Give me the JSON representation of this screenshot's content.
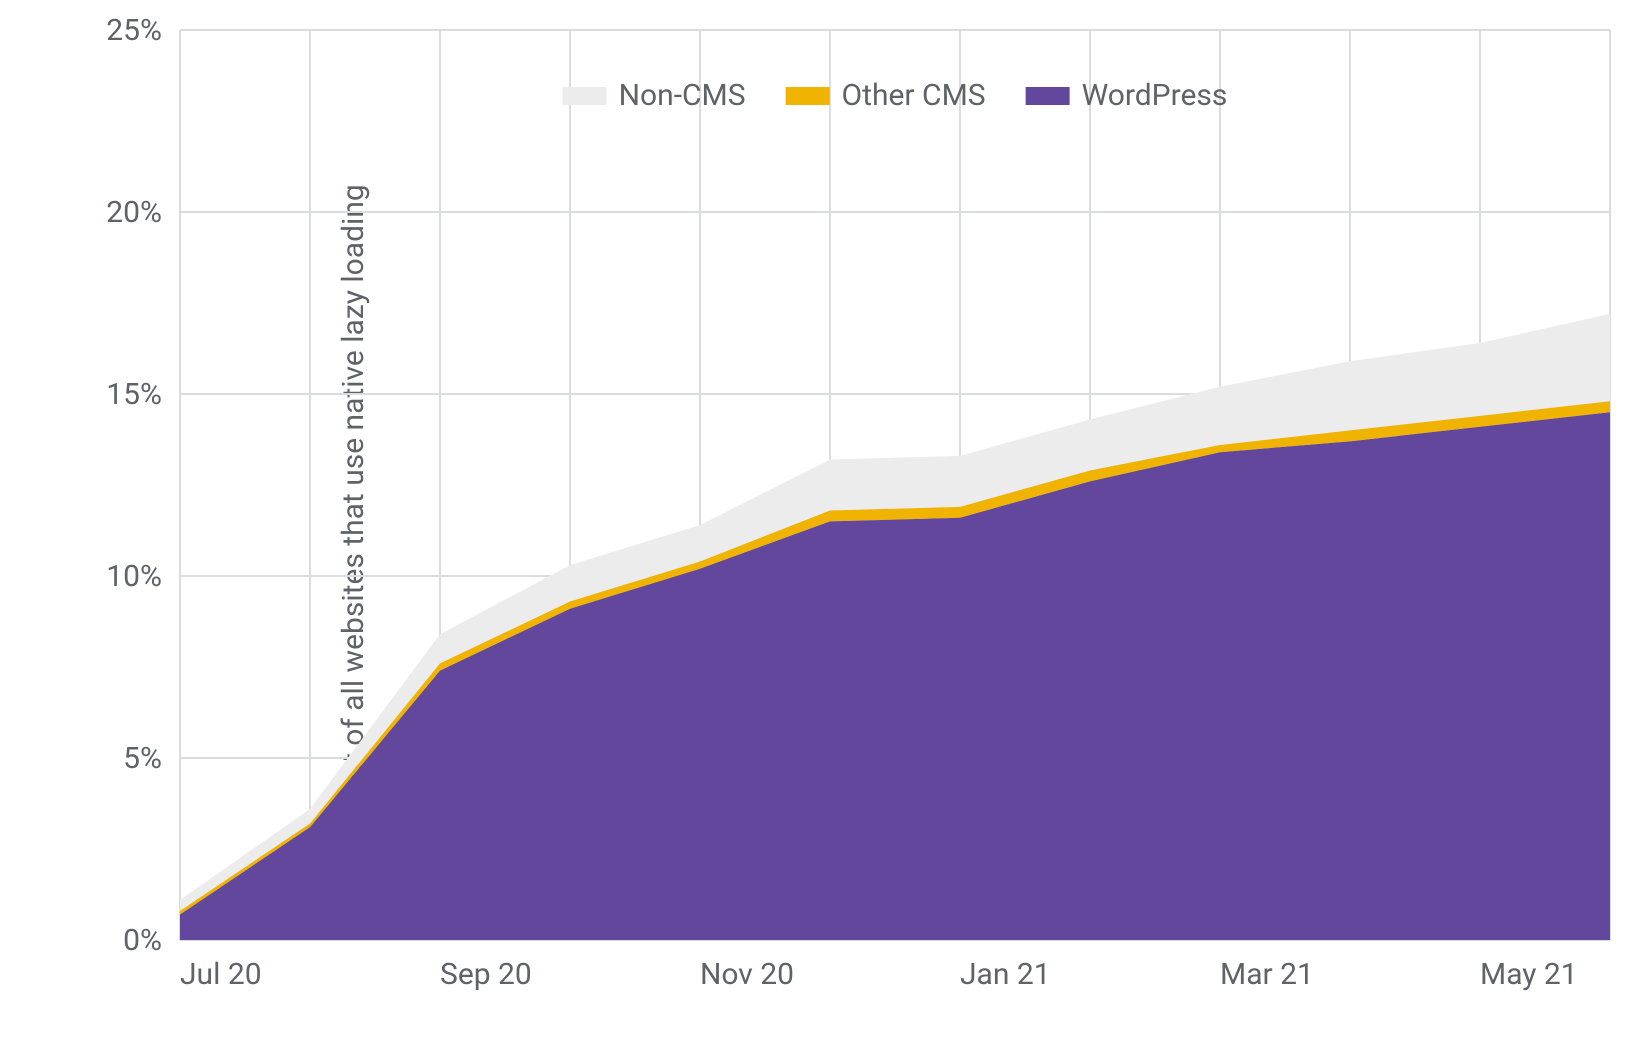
{
  "chart_data": {
    "type": "area",
    "ylabel": "Percent of all websites that use native lazy loading",
    "xlabel": "",
    "ylim": [
      0,
      25
    ],
    "yticks": [
      0,
      5,
      10,
      15,
      20,
      25
    ],
    "ytick_labels": [
      "0%",
      "5%",
      "10%",
      "15%",
      "20%",
      "25%"
    ],
    "categories": [
      "Jul 20",
      "Aug 20",
      "Sep 20",
      "Oct 20",
      "Nov 20",
      "Dec 20",
      "Jan 21",
      "Feb 21",
      "Mar 21",
      "Apr 21",
      "May 21",
      "Jun 21"
    ],
    "xtick_labels": [
      "Jul 20",
      "Sep 20",
      "Nov 20",
      "Jan 21",
      "Mar 21",
      "May 21"
    ],
    "xtick_indices": [
      0,
      2,
      4,
      6,
      8,
      10
    ],
    "series": [
      {
        "name": "WordPress",
        "color": "#63479c",
        "values": [
          0.7,
          3.1,
          7.4,
          9.1,
          10.2,
          11.5,
          11.6,
          12.6,
          13.4,
          13.7,
          14.1,
          14.5
        ]
      },
      {
        "name": "Other CMS",
        "color": "#f0b400",
        "values": [
          0.1,
          0.1,
          0.2,
          0.2,
          0.2,
          0.3,
          0.3,
          0.3,
          0.2,
          0.3,
          0.3,
          0.3
        ]
      },
      {
        "name": "Non-CMS",
        "color": "#ececec",
        "values": [
          0.3,
          0.4,
          0.8,
          1.0,
          1.0,
          1.4,
          1.4,
          1.4,
          1.6,
          1.9,
          2.0,
          2.4
        ]
      }
    ],
    "legend": {
      "order": [
        "Non-CMS",
        "Other CMS",
        "WordPress"
      ]
    }
  }
}
